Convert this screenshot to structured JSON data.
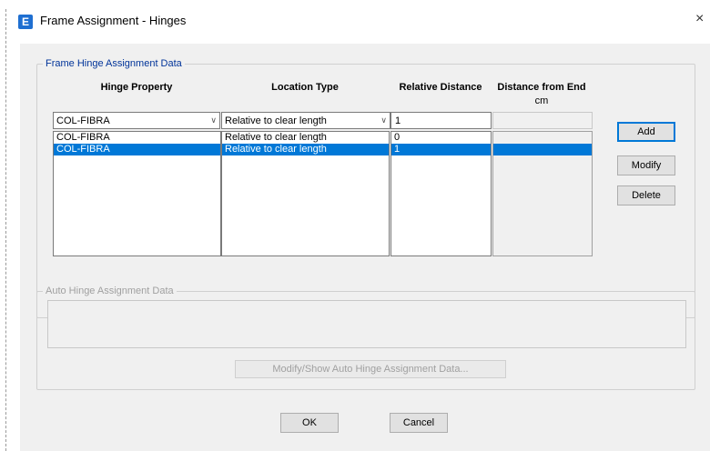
{
  "window": {
    "title": "Frame Assignment - Hinges",
    "app_icon_letter": "E",
    "close_symbol": "×"
  },
  "frame_hinge_group": {
    "legend": "Frame Hinge Assignment Data",
    "headers": {
      "hinge_property": "Hinge Property",
      "location_type": "Location Type",
      "relative_distance": "Relative Distance",
      "distance_from_end": "Distance from End",
      "distance_unit": "cm"
    },
    "inputs": {
      "hinge_property_value": "COL-FIBRA",
      "location_type_value": "Relative to clear length",
      "relative_distance_value": "1"
    },
    "rows": [
      {
        "hinge_property": "COL-FIBRA",
        "location_type": "Relative to clear length",
        "relative_distance": "0",
        "distance_from_end": ""
      },
      {
        "hinge_property": "COL-FIBRA",
        "location_type": "Relative to clear length",
        "relative_distance": "1",
        "distance_from_end": ""
      }
    ],
    "buttons": {
      "add": "Add",
      "modify": "Modify",
      "delete": "Delete"
    }
  },
  "auto_hinge_group": {
    "legend": "Auto Hinge Assignment Data",
    "button": "Modify/Show Auto Hinge Assignment Data..."
  },
  "footer": {
    "ok": "OK",
    "cancel": "Cancel"
  },
  "colors": {
    "selection": "#0078d7",
    "legend_active": "#003399",
    "app_icon": "#1f6fd1"
  },
  "icons": {
    "combo_arrow": "chevron-down-icon"
  }
}
